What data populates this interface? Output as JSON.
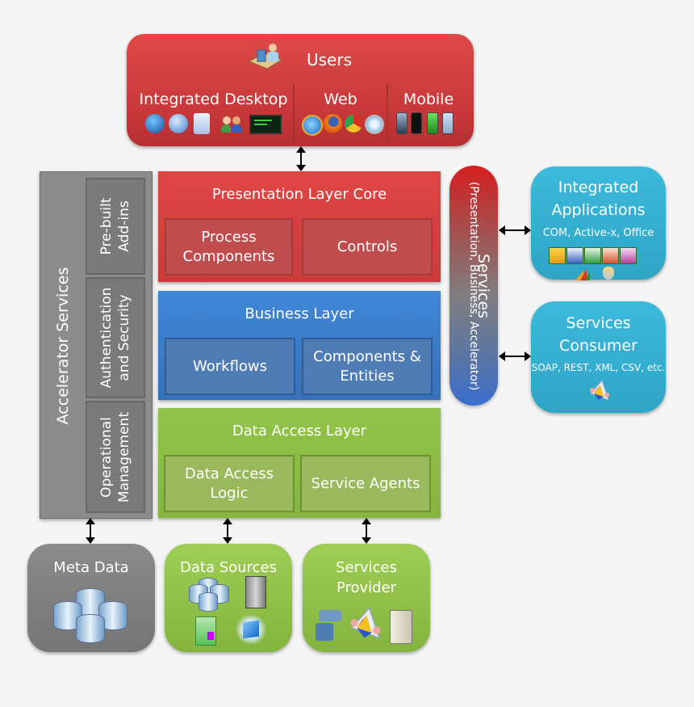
{
  "users": {
    "title": "Users",
    "icon": "user-at-desk-icon",
    "groups": [
      {
        "label": "Integrated Desktop",
        "icons": [
          "windows-icon",
          "globe-icon",
          "outlook-icon",
          "messenger-icon",
          "terminal-icon"
        ]
      },
      {
        "label": "Web",
        "icons": [
          "internet-explorer-icon",
          "firefox-icon",
          "chrome-icon",
          "safari-icon"
        ]
      },
      {
        "label": "Mobile",
        "icons": [
          "phone-icon",
          "iphone-icon",
          "android-phone-icon",
          "blackberry-icon"
        ]
      }
    ]
  },
  "accelerator": {
    "title": "Accelerator Services",
    "items": [
      {
        "line1": "Pre-built",
        "line2": "Add-ins"
      },
      {
        "line1": "Authentication",
        "line2": "and Security"
      },
      {
        "line1": "Operational",
        "line2": "Management"
      }
    ]
  },
  "layers": {
    "presentation": {
      "title": "Presentation Layer Core",
      "left": "Process Components",
      "left1": "Process",
      "left2": "Components",
      "right": "Controls",
      "color": "#d84242"
    },
    "business": {
      "title": "Business Layer",
      "left": "Workflows",
      "right1": "Components &",
      "right2": "Entities",
      "color": "#3a7ccb"
    },
    "data_access": {
      "title": "Data Access Layer",
      "left1": "Data Access",
      "left2": "Logic",
      "right": "Service Agents",
      "color": "#8dbd45"
    }
  },
  "services": {
    "title": "Services",
    "subtitle": "(Presentation, Business, Accelerator)"
  },
  "integrated_apps": {
    "title1": "Integrated",
    "title2": "Applications",
    "subtitle": "COM, Active-x, Office",
    "icons": [
      "outlook-icon",
      "word-icon",
      "excel-icon",
      "powerpoint-icon",
      "onenote-icon",
      "dynamics-icon",
      "sql-server-icon"
    ]
  },
  "services_consumer": {
    "title1": "Services",
    "title2": "Consumer",
    "subtitle": "SOAP, REST, XML, CSV, etc.",
    "icon": "biztalk-icon"
  },
  "bottom": {
    "meta": {
      "title": "Meta Data",
      "icon": "database-cluster-icon"
    },
    "data_sources": {
      "title": "Data Sources",
      "icons": [
        "database-cluster-icon",
        "server-icon",
        "software-box-icon",
        "windows-azure-icon"
      ]
    },
    "services_provider": {
      "title1": "Services",
      "title2": "Provider",
      "icons": [
        "network-icon",
        "biztalk-icon",
        "server-tower-icon"
      ]
    }
  }
}
